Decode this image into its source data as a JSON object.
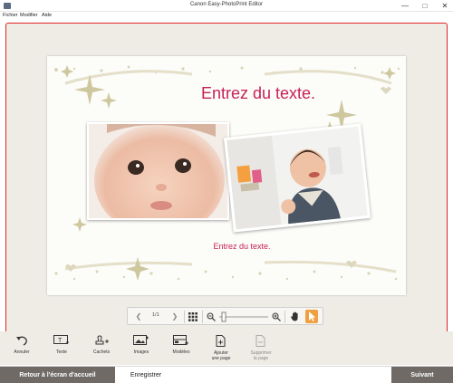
{
  "window": {
    "title": "Canon Easy-PhotoPrint Editor"
  },
  "menu": {
    "items": [
      "Fichier",
      "Modifier",
      "Aide"
    ]
  },
  "canvas": {
    "title_placeholder": "Entrez du texte.",
    "subtitle_placeholder": "Entrez du texte."
  },
  "page_nav": {
    "page_indicator": "1/1"
  },
  "tools": [
    {
      "label": "Annuler",
      "icon": "undo-icon"
    },
    {
      "label": "Texte",
      "icon": "text-icon"
    },
    {
      "label": "Cachets",
      "icon": "stamp-icon"
    },
    {
      "label": "Images",
      "icon": "image-icon"
    },
    {
      "label": "Modèles",
      "icon": "template-icon"
    },
    {
      "label_line1": "Ajouter",
      "label_line2": "une page",
      "icon": "add-page-icon"
    },
    {
      "label_line1": "Supprimer",
      "label_line2": "la page",
      "icon": "delete-page-icon"
    }
  ],
  "footer": {
    "back_label": "Retour à l'écran d'accueil",
    "save_label": "Enregistrer",
    "next_label": "Suivant"
  },
  "colors": {
    "accent": "#e02424",
    "text_placeholder": "#c8205a",
    "footer_button": "#6f6a66",
    "cursor_tool": "#f0a040"
  }
}
